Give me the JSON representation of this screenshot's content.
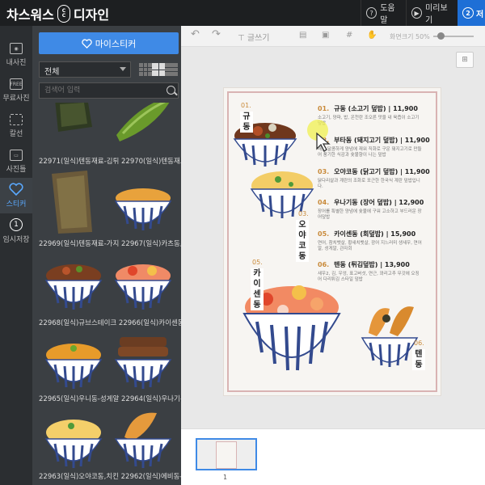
{
  "app": {
    "logo_left": "차스워스",
    "logo_mark_top": "C",
    "logo_mark_mid": "C",
    "logo_right": "디자인",
    "help": "도움말",
    "help_num": "?",
    "preview": "미리보기",
    "step_num": "2",
    "step_label": "저"
  },
  "nav": [
    {
      "label": "내사진",
      "icon": "photo-icon"
    },
    {
      "label": "무료사진",
      "icon": "free-photo-icon",
      "badge": "FREE"
    },
    {
      "label": "칼선",
      "icon": "cutline-icon"
    },
    {
      "label": "사진틀",
      "icon": "frame-icon"
    },
    {
      "label": "스티커",
      "icon": "heart-icon"
    },
    {
      "label": "임시저장",
      "icon": "temp-save-icon",
      "badge": "1"
    }
  ],
  "panel": {
    "fav_button": "마이스티커",
    "select_value": "전체",
    "search_placeholder": "검색어 입력",
    "items": [
      {
        "label": "22971(일식)텐동재료-김튀 22970(일식)텐동재료-고추"
      },
      {
        "label": "22969(일식)텐동재료-가지 22967(일식)카츠동,돈부리"
      },
      {
        "label": "22968(일식)규브스테이크 22966(일식)카이센동-회덮"
      },
      {
        "label": "22965(일식)우니동-성게알 22964(일식)우나기동-장어"
      },
      {
        "label": "22963(일식)오야코동,치킨 22962(일식)에비동-새우튀"
      }
    ]
  },
  "toolbar": {
    "text_tool": "글쓰기",
    "zoom_label": "화면크기",
    "zoom_value": "50%"
  },
  "menu": [
    {
      "num": "01.",
      "title": "규동 (소고기 덮밥) | 11,900",
      "desc": "소고기, 양파, 밥, 온천란 조오른 맛을 내 육즙이 소고기 덮밥"
    },
    {
      "num": "02.",
      "title": "부타동 (돼지고기 덮밥) | 11,900",
      "desc": "매콤 달콤하게 양념에 재워 직화로 구운 돼지고기로 만들어 풍기한 식감과 숯불향이 나는 덮밥"
    },
    {
      "num": "03.",
      "title": "오야코동 (닭고기 덮밥) | 11,900",
      "desc": "닭다리살과 계란의 조화로 포근한 한국식 계란 덮밥입니다."
    },
    {
      "num": "04.",
      "title": "우나기동 (장어 덮밥) | 12,900",
      "desc": "장어를 특별한 양념에 숯불에 구워 고소하고 부드러운 장어덮밥"
    },
    {
      "num": "05.",
      "title": "카이센동 (회덮밥) | 15,900",
      "desc": "연어, 참치뱃살, 황새치뱃살, 광어 지느러미 생새우, 연어알, 성게알, 관자회"
    },
    {
      "num": "06.",
      "title": "텐동 (튀김덮밥) | 13,900",
      "desc": "새우2, 김, 우엉, 표고버섯, 연근, 꽈리고추 무갓에 오징어 다리튀김 스타일 덮밥"
    }
  ],
  "labels": {
    "l1": "규동",
    "n1": "01.",
    "l3": "오야코동",
    "n3": "03.",
    "l5": "카이센동",
    "n5": "05.",
    "l6": "텐동",
    "n6": "06."
  },
  "pages": {
    "current": "1"
  },
  "colors": {
    "accent": "#3f8ae6",
    "save": "#1e6fd6",
    "price_num": "#c98a3a"
  }
}
